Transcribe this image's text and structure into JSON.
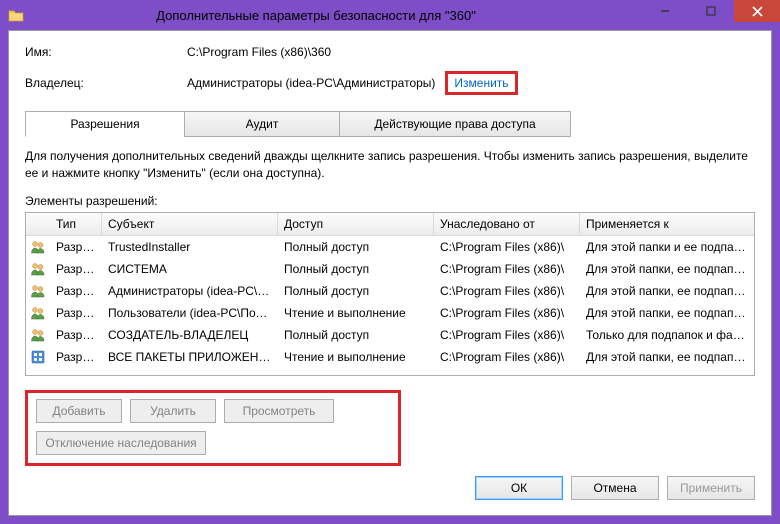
{
  "window": {
    "title": "Дополнительные параметры безопасности  для \"360\""
  },
  "fields": {
    "name_label": "Имя:",
    "name_value": "C:\\Program Files (x86)\\360",
    "owner_label": "Владелец:",
    "owner_value": "Администраторы (idea-PC\\Администраторы)",
    "change_link": "Изменить"
  },
  "tabs": {
    "permissions": "Разрешения",
    "audit": "Аудит",
    "effective": "Действующие права доступа"
  },
  "panel": {
    "description": "Для получения дополнительных сведений дважды щелкните запись разрешения. Чтобы изменить запись разрешения, выделите ее и нажмите кнопку \"Изменить\" (если она доступна).",
    "subheading": "Элементы разрешений:"
  },
  "columns": {
    "type": "Тип",
    "principal": "Субъект",
    "access": "Доступ",
    "inherited": "Унаследовано от",
    "applies": "Применяется к"
  },
  "rows": [
    {
      "icon": "group",
      "type": "Разр…",
      "principal": "TrustedInstaller",
      "access": "Полный доступ",
      "inherited": "C:\\Program Files (x86)\\",
      "applies": "Для этой папки и ее подпапок"
    },
    {
      "icon": "group",
      "type": "Разр…",
      "principal": "СИСТЕМА",
      "access": "Полный доступ",
      "inherited": "C:\\Program Files (x86)\\",
      "applies": "Для этой папки, ее подпапок …"
    },
    {
      "icon": "group",
      "type": "Разр…",
      "principal": "Администраторы (idea-PC\\А…",
      "access": "Полный доступ",
      "inherited": "C:\\Program Files (x86)\\",
      "applies": "Для этой папки, ее подпапок …"
    },
    {
      "icon": "group",
      "type": "Разр…",
      "principal": "Пользователи (idea-PC\\Пол…",
      "access": "Чтение и выполнение",
      "inherited": "C:\\Program Files (x86)\\",
      "applies": "Для этой папки, ее подпапок …"
    },
    {
      "icon": "group",
      "type": "Разр…",
      "principal": "СОЗДАТЕЛЬ-ВЛАДЕЛЕЦ",
      "access": "Полный доступ",
      "inherited": "C:\\Program Files (x86)\\",
      "applies": "Только для подпапок и файл…"
    },
    {
      "icon": "app",
      "type": "Разр…",
      "principal": "ВСЕ ПАКЕТЫ ПРИЛОЖЕНИЙ",
      "access": "Чтение и выполнение",
      "inherited": "C:\\Program Files (x86)\\",
      "applies": "Для этой папки, ее подпапок …"
    }
  ],
  "buttons": {
    "add": "Добавить",
    "remove": "Удалить",
    "view": "Просмотреть",
    "disable_inherit": "Отключение наследования",
    "ok": "ОК",
    "cancel": "Отмена",
    "apply": "Применить"
  },
  "icons": {
    "group": "group-icon",
    "app": "app-package-icon"
  }
}
